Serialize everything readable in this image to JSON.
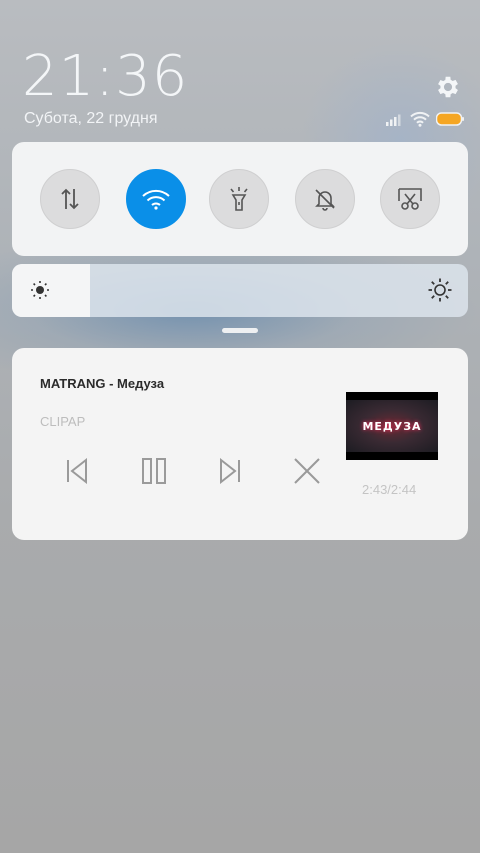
{
  "header": {
    "time": "21:36",
    "date": "Субота, 22 грудня",
    "settings_icon": "gear-icon",
    "status_icons": [
      "signal-icon",
      "wifi-icon",
      "battery-icon"
    ],
    "battery_color": "#f5a623"
  },
  "quick_settings": {
    "toggles": [
      {
        "name": "mobile-data",
        "icon": "data-arrows-icon",
        "active": false
      },
      {
        "name": "wifi",
        "icon": "wifi-icon",
        "active": true
      },
      {
        "name": "flashlight",
        "icon": "flashlight-icon",
        "active": false
      },
      {
        "name": "silent",
        "icon": "bell-off-icon",
        "active": false
      },
      {
        "name": "screenshot",
        "icon": "scissors-icon",
        "active": false
      }
    ],
    "accent_color": "#0a8fe8"
  },
  "brightness": {
    "level_percent": 17
  },
  "media": {
    "title": "MATRANG - Медуза",
    "artist": "CLIPAP",
    "thumbnail_text": "МЕДУЗА",
    "time": "2:43/2:44",
    "controls": [
      "previous-icon",
      "pause-icon",
      "next-icon",
      "close-icon"
    ]
  }
}
